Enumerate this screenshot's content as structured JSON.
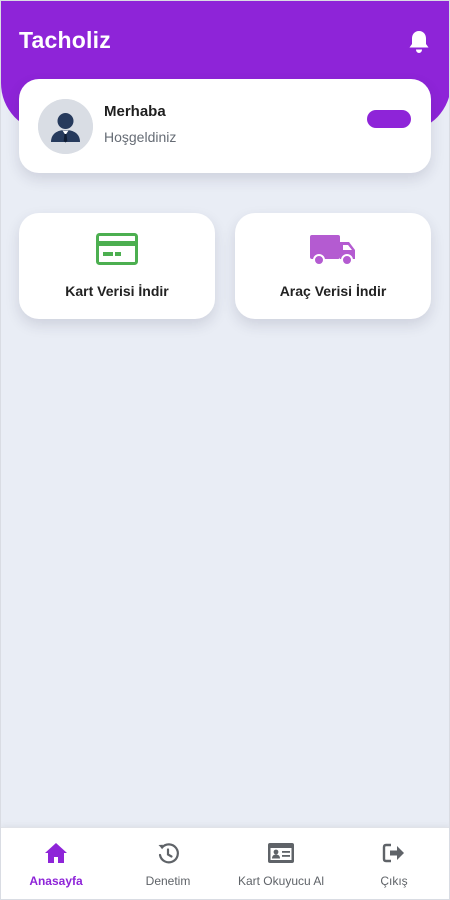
{
  "header": {
    "title": "Tacholiz",
    "bell_icon": "bell-icon",
    "background_color": "#8e24d8"
  },
  "welcome": {
    "greeting": "Merhaba",
    "subtitle": "Hoşgeldiniz",
    "avatar_icon": "user-avatar-icon",
    "toggle_color": "#8e24d8"
  },
  "actions": [
    {
      "label": "Kart Verisi İndir",
      "icon": "credit-card-icon",
      "icon_color": "#4caf50"
    },
    {
      "label": "Araç Verisi İndir",
      "icon": "truck-icon",
      "icon_color": "#b45bd1"
    }
  ],
  "bottom_nav": {
    "active_color": "#8e24d8",
    "items": [
      {
        "label": "Anasayfa",
        "icon": "home-icon",
        "active": true
      },
      {
        "label": "Denetim",
        "icon": "history-icon",
        "active": false
      },
      {
        "label": "Kart Okuyucu Al",
        "icon": "id-card-icon",
        "active": false
      },
      {
        "label": "Çıkış",
        "icon": "logout-icon",
        "active": false
      }
    ]
  }
}
